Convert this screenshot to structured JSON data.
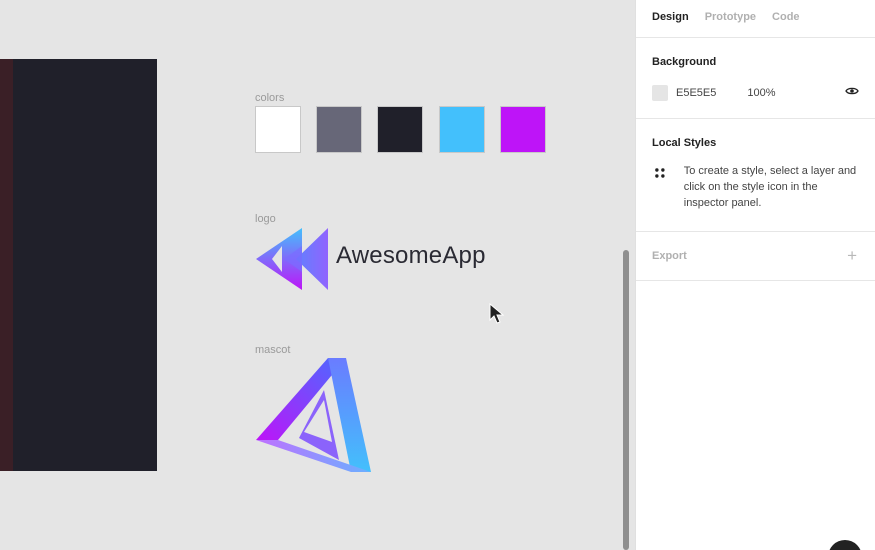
{
  "canvas": {
    "colors_label": "colors",
    "logo_label": "logo",
    "mascot_label": "mascot",
    "swatches": [
      "#FFFFFF",
      "#676778",
      "#20202A",
      "#43C0FC",
      "#BE14F8"
    ],
    "logo_text": "AwesomeApp"
  },
  "panel": {
    "tabs": [
      "Design",
      "Prototype",
      "Code"
    ],
    "active_tab": "Design",
    "background": {
      "title": "Background",
      "hex": "E5E5E5",
      "opacity": "100%"
    },
    "local_styles": {
      "title": "Local Styles",
      "hint": "To create a style, select a layer and click on the style icon in the inspector panel."
    },
    "export": {
      "title": "Export",
      "add": "+"
    }
  },
  "icons": [
    "eye-icon",
    "style-dots-icon",
    "plus-icon",
    "cursor-arrow-icon",
    "help-icon"
  ]
}
